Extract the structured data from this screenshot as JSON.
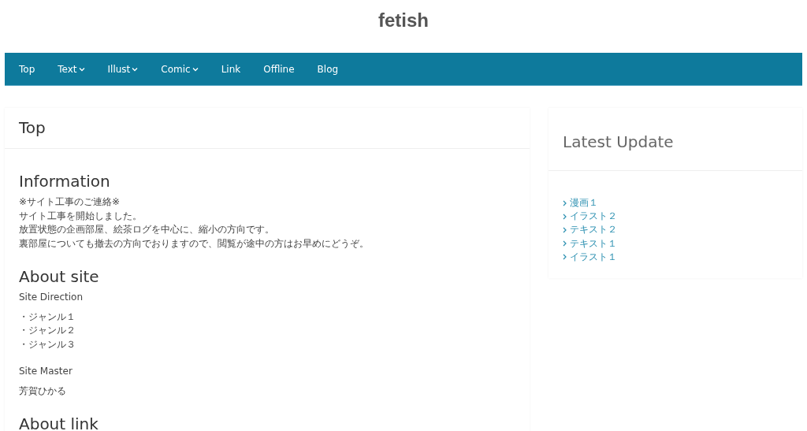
{
  "site_title": "fetish",
  "nav": [
    {
      "label": "Top",
      "has_dropdown": false
    },
    {
      "label": "Text",
      "has_dropdown": true
    },
    {
      "label": "Illust",
      "has_dropdown": true
    },
    {
      "label": "Comic",
      "has_dropdown": true
    },
    {
      "label": "Link",
      "has_dropdown": false
    },
    {
      "label": "Offline",
      "has_dropdown": false
    },
    {
      "label": "Blog",
      "has_dropdown": false
    }
  ],
  "main": {
    "title": "Top",
    "sections": [
      {
        "heading": "Information",
        "blocks": [
          {
            "kind": "lines",
            "lines": [
              "※サイト工事のご連絡※",
              "サイト工事を開始しました。",
              "放置状態の企画部屋、絵茶ログを中心に、縮小の方向です。",
              "裏部屋についても撤去の方向でおりますので、閲覧が途中の方はお早めにどうぞ。"
            ]
          }
        ]
      },
      {
        "heading": "About site",
        "blocks": [
          {
            "kind": "para",
            "lines": [
              "Site Direction"
            ]
          },
          {
            "kind": "para",
            "lines": [
              "・ジャンル１",
              "・ジャンル２",
              "・ジャンル３"
            ]
          },
          {
            "kind": "spacer"
          },
          {
            "kind": "para",
            "lines": [
              "Site Master"
            ]
          },
          {
            "kind": "para",
            "lines": [
              "芳賀ひかる"
            ]
          }
        ]
      },
      {
        "heading": "About link"
      }
    ]
  },
  "sidebar": {
    "title": "Latest Update",
    "items": [
      "漫画１",
      "イラスト２",
      "テキスト２",
      "テキスト１",
      "イラスト１"
    ]
  }
}
